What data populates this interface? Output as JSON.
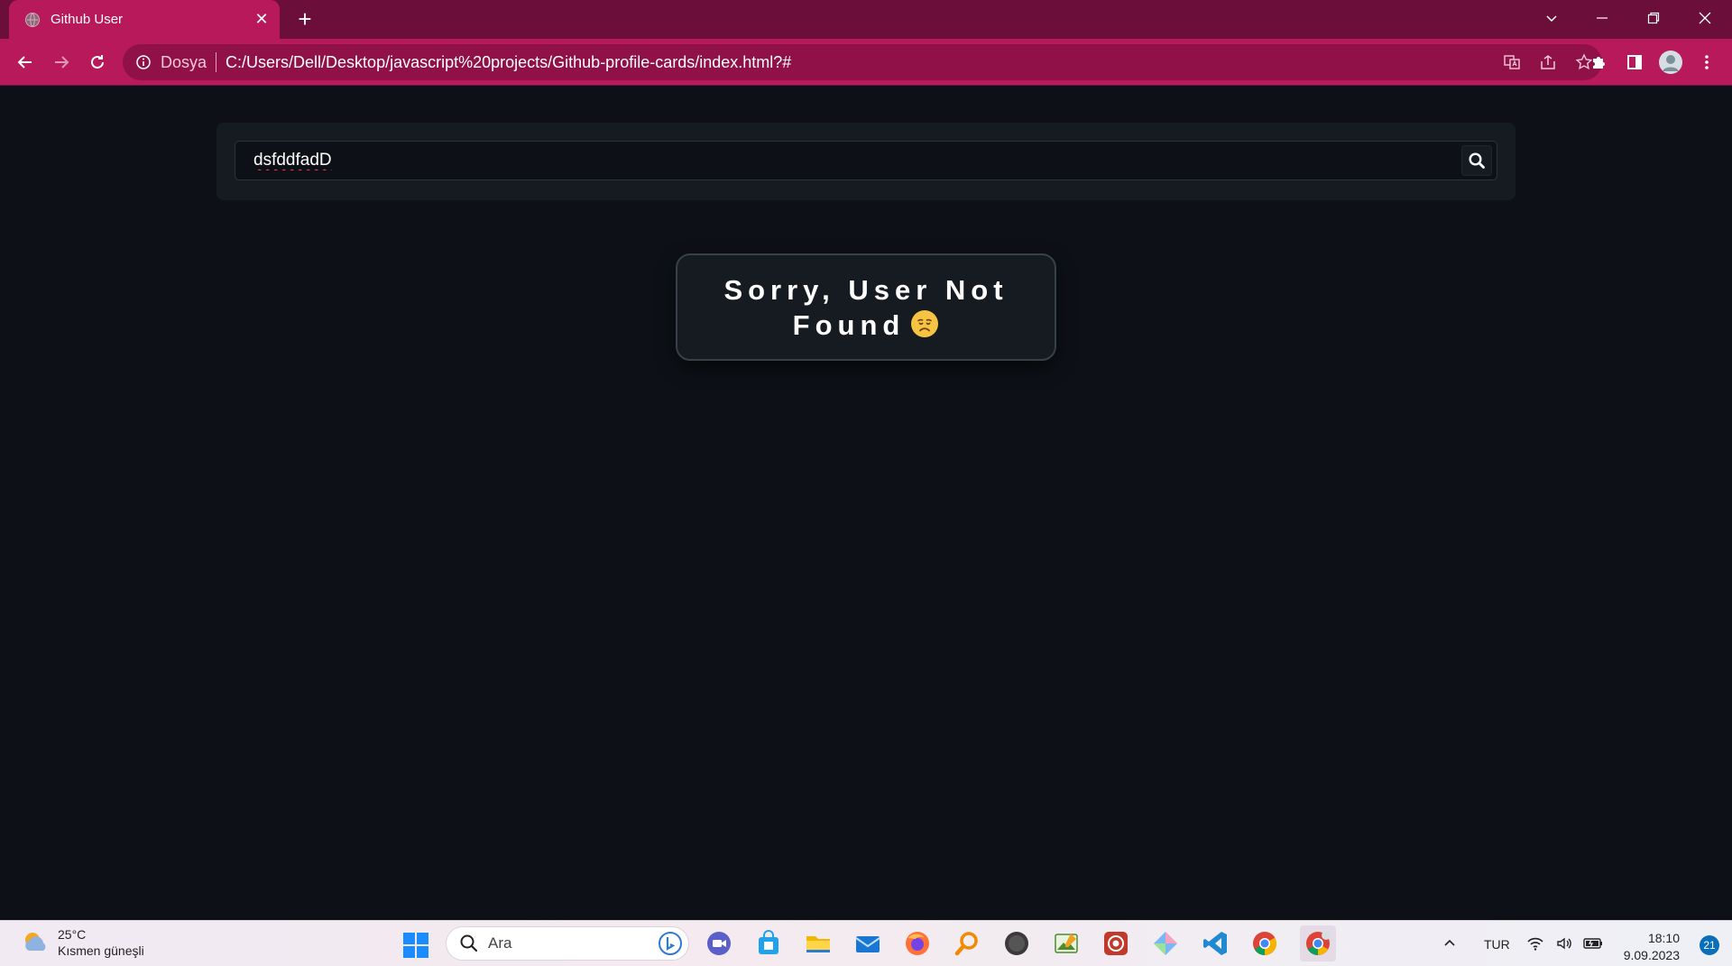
{
  "browser": {
    "tab": {
      "title": "Github User"
    },
    "address": {
      "scheme_label": "Dosya",
      "url": "C:/Users/Dell/Desktop/javascript%20projects/Github-profile-cards/index.html?#"
    }
  },
  "page": {
    "search": {
      "value": "dsfddfadD"
    },
    "error": {
      "message": "Sorry, User Not Found"
    }
  },
  "taskbar": {
    "weather": {
      "temperature": "25°C",
      "condition": "Kısmen güneşli"
    },
    "search_label": "Ara",
    "language": "TUR",
    "time": "18:10",
    "date": "9.09.2023",
    "notification_count": "21"
  },
  "colors": {
    "tab_active": "#b8195a",
    "tabstrip": "#6b0e3a",
    "page_bg": "#0d1117",
    "panel_bg": "#161b22"
  }
}
